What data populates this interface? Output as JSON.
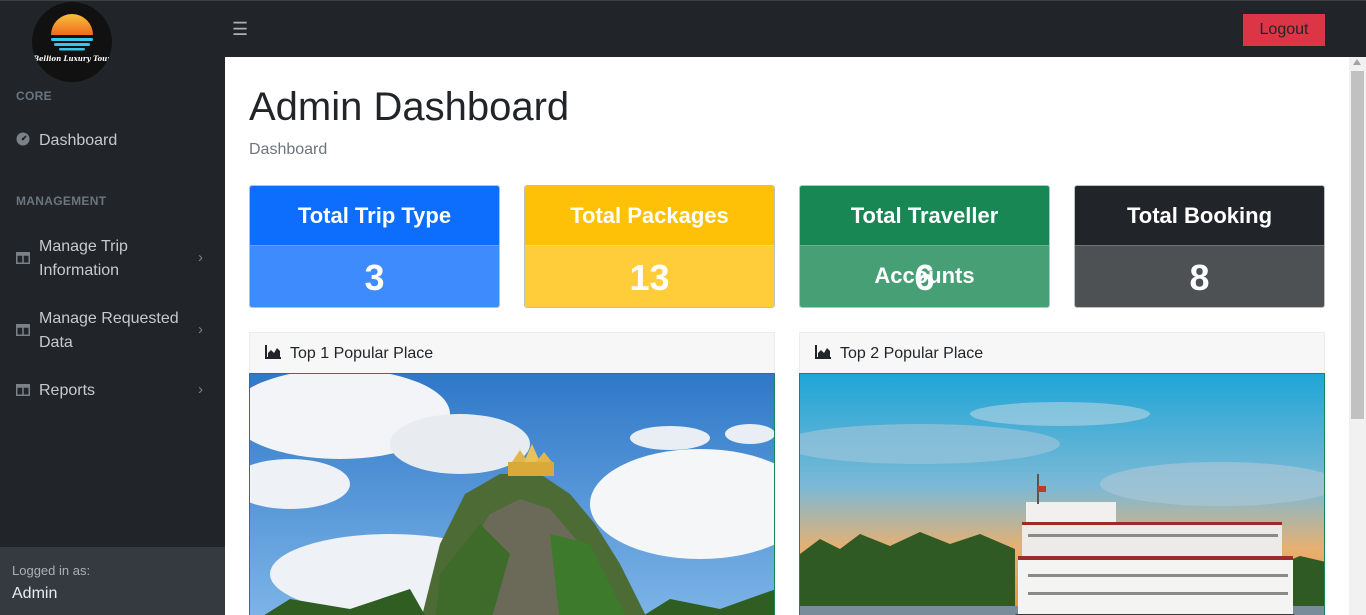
{
  "brand": {
    "logo_text": "Bellion Luxury Tour"
  },
  "topbar": {
    "logout_label": "Logout"
  },
  "sidebar": {
    "core_heading": "CORE",
    "dashboard_label": "Dashboard",
    "management_heading": "MANAGEMENT",
    "items": [
      {
        "line1": "Manage Trip",
        "line2": "Information"
      },
      {
        "line1": "Manage Requested",
        "line2": "Data"
      },
      {
        "line1": "Reports",
        "line2": ""
      }
    ],
    "footer": {
      "logged_in_label": "Logged in as:",
      "user": "Admin"
    }
  },
  "main": {
    "title": "Admin Dashboard",
    "breadcrumb": "Dashboard",
    "stats": [
      {
        "label": "Total Trip Type",
        "value": "3",
        "head_color": "#0d6efd",
        "body_color": "#3d8bfd"
      },
      {
        "label": "Total Packages",
        "value": "13",
        "head_color": "#ffc107",
        "body_color": "#ffcd39"
      },
      {
        "label": "Total Traveller Accounts",
        "value": "6",
        "head_color": "#198754",
        "body_color": "#479f76"
      },
      {
        "label": "Total Booking",
        "value": "8",
        "head_color": "#212529",
        "body_color": "#4d5154"
      }
    ],
    "places": [
      {
        "title": "Top 1 Popular Place"
      },
      {
        "title": "Top 2 Popular Place"
      }
    ]
  }
}
